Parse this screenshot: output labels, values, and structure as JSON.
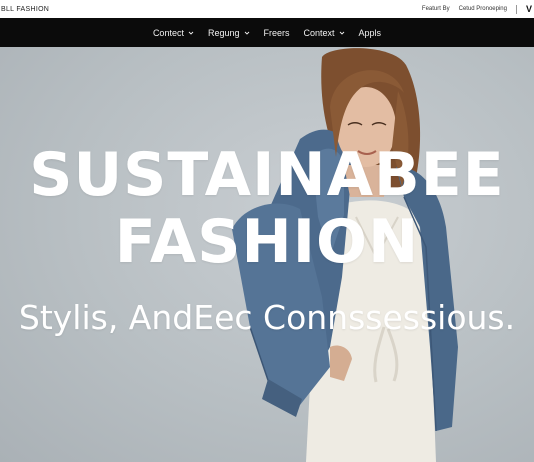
{
  "header": {
    "brand": "BLL FASHION",
    "links": [
      "Featurt By",
      "Cetud Pronoeping"
    ],
    "cut_text": "V"
  },
  "nav": {
    "items": [
      {
        "label": "Contect",
        "has_dropdown": true
      },
      {
        "label": "Regung",
        "has_dropdown": true
      },
      {
        "label": "Freers",
        "has_dropdown": false
      },
      {
        "label": "Context",
        "has_dropdown": true
      },
      {
        "label": "Appls",
        "has_dropdown": false
      }
    ],
    "icon": "chevron-down-icon"
  },
  "hero": {
    "headline_line1": "SUSTAINABEE",
    "headline_line2": "FASHION",
    "tagline": "Stylis, AndEec Connssessious.",
    "image": "model-in-denim-jacket-photo"
  },
  "colors": {
    "nav_background": "#0b0b0b",
    "hero_background": "#b8bfc3",
    "denim": "#4c6a8c",
    "dress": "#eeebe3",
    "hair": "#8a5a36"
  }
}
